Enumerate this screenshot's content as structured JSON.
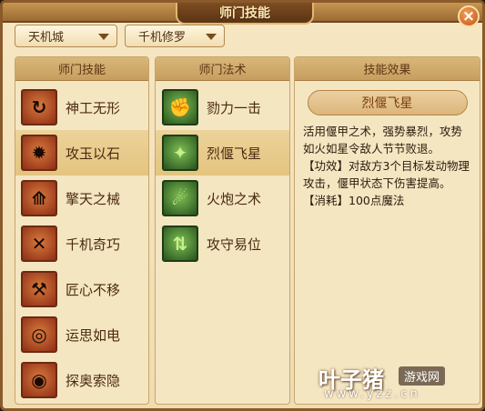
{
  "window": {
    "title": "师门技能"
  },
  "filters": {
    "sect": "天机城",
    "path": "千机修罗"
  },
  "skills_panel": {
    "header": "师门技能",
    "items": [
      {
        "name": "神工无形",
        "icon": "swirl-arrow-icon"
      },
      {
        "name": "攻玉以石",
        "icon": "stone-crush-icon",
        "selected": true
      },
      {
        "name": "擎天之械",
        "icon": "pillar-icon"
      },
      {
        "name": "千机奇巧",
        "icon": "cross-gear-icon"
      },
      {
        "name": "匠心不移",
        "icon": "hammer-icon"
      },
      {
        "name": "运思如电",
        "icon": "vortex-icon"
      },
      {
        "name": "探奥索隐",
        "icon": "spiral-eye-icon"
      }
    ]
  },
  "spells_panel": {
    "header": "师门法术",
    "items": [
      {
        "name": "勠力一击",
        "icon": "fist-icon"
      },
      {
        "name": "烈偃飞星",
        "icon": "flying-star-icon",
        "selected": true
      },
      {
        "name": "火炮之术",
        "icon": "cannon-beast-icon"
      },
      {
        "name": "攻守易位",
        "icon": "swap-stance-icon"
      }
    ]
  },
  "effect_panel": {
    "header": "技能效果",
    "title": "烈偃飞星",
    "lines": [
      "活用偃甲之术，强势暴烈，攻势如火如星令敌人节节败退。",
      "【功效】对敌方3个目标发动物理攻击，偃甲状态下伤害提高。",
      "【消耗】100点魔法"
    ]
  },
  "watermark": {
    "brand": "叶子猪",
    "badge": "游戏网",
    "url": "www.yzz.cn"
  },
  "colors": {
    "frame": "#8a5a2b",
    "panel_bg": "#f5e6c2",
    "selected_row": "#e4c47f",
    "close_button": "#c0541a"
  }
}
